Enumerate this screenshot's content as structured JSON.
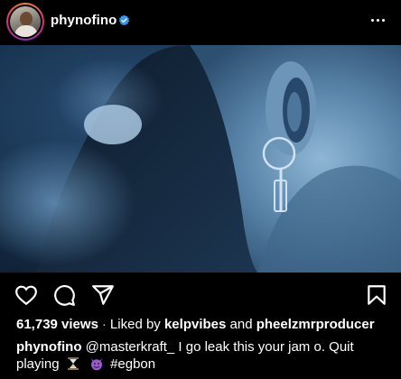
{
  "post": {
    "username": "phynofino",
    "views": "61,739 views",
    "separator": "·",
    "liked_by_prefix": "Liked by",
    "liked_by_user1": "kelpvibes",
    "liked_by_and": "and",
    "liked_by_user2": "pheelzmrproducer",
    "caption_username": "phynofino",
    "caption_text": "@masterkraft_ I go leak this your jam o. Quit playing",
    "caption_hashtag": "#egbon"
  },
  "icons": {
    "verified": "verified-badge-icon",
    "more": "more-options-icon",
    "like": "heart-icon",
    "comment": "comment-icon",
    "share": "paper-plane-icon",
    "save": "bookmark-icon",
    "emoji1": "hourglass-icon",
    "emoji2": "smiling-imp-icon"
  },
  "colors": {
    "verified_badge": "#3897f0",
    "photo_tint": "#1b3a5c"
  }
}
